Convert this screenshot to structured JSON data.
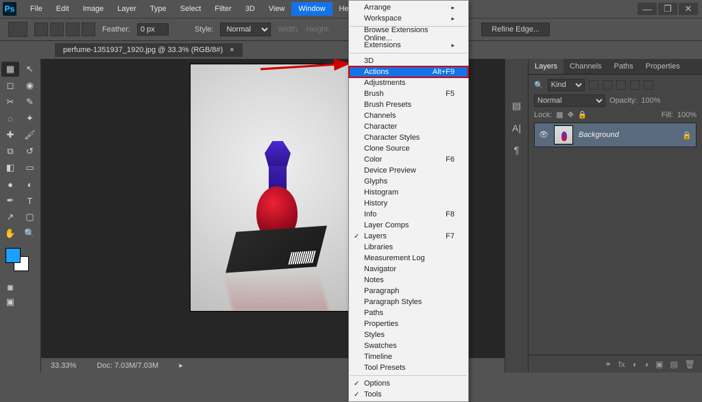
{
  "app": {
    "logo": "Ps"
  },
  "menubar": [
    "File",
    "Edit",
    "Image",
    "Layer",
    "Type",
    "Select",
    "Filter",
    "3D",
    "View",
    "Window",
    "Help"
  ],
  "menubar_open_index": 9,
  "window_menu": {
    "groups": [
      [
        {
          "label": "Arrange",
          "sub": true
        },
        {
          "label": "Workspace",
          "sub": true
        }
      ],
      [
        {
          "label": "Browse Extensions Online..."
        },
        {
          "label": "Extensions",
          "sub": true
        }
      ],
      [
        {
          "label": "3D"
        },
        {
          "label": "Actions",
          "shortcut": "Alt+F9",
          "highlight": true
        },
        {
          "label": "Adjustments"
        },
        {
          "label": "Brush",
          "shortcut": "F5"
        },
        {
          "label": "Brush Presets"
        },
        {
          "label": "Channels"
        },
        {
          "label": "Character"
        },
        {
          "label": "Character Styles"
        },
        {
          "label": "Clone Source"
        },
        {
          "label": "Color",
          "shortcut": "F6"
        },
        {
          "label": "Device Preview"
        },
        {
          "label": "Glyphs"
        },
        {
          "label": "Histogram"
        },
        {
          "label": "History"
        },
        {
          "label": "Info",
          "shortcut": "F8"
        },
        {
          "label": "Layer Comps"
        },
        {
          "label": "Layers",
          "shortcut": "F7",
          "checked": true
        },
        {
          "label": "Libraries"
        },
        {
          "label": "Measurement Log"
        },
        {
          "label": "Navigator"
        },
        {
          "label": "Notes"
        },
        {
          "label": "Paragraph"
        },
        {
          "label": "Paragraph Styles"
        },
        {
          "label": "Paths"
        },
        {
          "label": "Properties"
        },
        {
          "label": "Styles"
        },
        {
          "label": "Swatches"
        },
        {
          "label": "Timeline"
        },
        {
          "label": "Tool Presets"
        }
      ],
      [
        {
          "label": "Options",
          "checked": true
        },
        {
          "label": "Tools",
          "checked": true
        }
      ]
    ]
  },
  "optionsbar": {
    "feather_label": "Feather:",
    "feather_value": "0 px",
    "style_label": "Style:",
    "style_value": "Normal",
    "width_label": "Width:",
    "height_label": "Height:",
    "refine": "Refine Edge..."
  },
  "document": {
    "tab_title": "perfume-1351937_1920.jpg @ 33.3% (RGB/8#)"
  },
  "status": {
    "zoom": "33.33%",
    "doc": "Doc: 7.03M/7.03M"
  },
  "panels": {
    "tabs": [
      "Layers",
      "Channels",
      "Paths",
      "Properties"
    ],
    "kind_label": "Kind",
    "blend_mode": "Normal",
    "opacity_label": "Opacity:",
    "opacity_value": "100%",
    "lock_label": "Lock:",
    "fill_label": "Fill:",
    "fill_value": "100%",
    "layer_name": "Background"
  },
  "winctrl": {
    "min": "—",
    "max": "❐",
    "close": "✕"
  }
}
